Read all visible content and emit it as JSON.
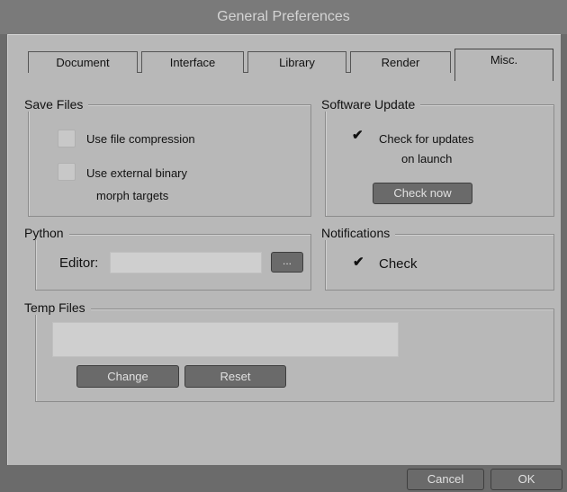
{
  "window": {
    "title": "General Preferences"
  },
  "tabs": [
    {
      "label": "Document",
      "active": false
    },
    {
      "label": "Interface",
      "active": false
    },
    {
      "label": "Library",
      "active": false
    },
    {
      "label": "Render",
      "active": false
    },
    {
      "label": "Misc.",
      "active": true
    }
  ],
  "save_files": {
    "title": "Save Files",
    "compression": {
      "label": "Use file compression",
      "checked": false
    },
    "external_binary": {
      "label_line1": "Use external binary",
      "label_line2": "morph targets",
      "checked": false
    }
  },
  "software_update": {
    "title": "Software Update",
    "check_launch": {
      "label_line1": "Check for updates",
      "label_line2": "on launch",
      "checked": true
    },
    "check_now_label": "Check now"
  },
  "python": {
    "title": "Python",
    "editor_label": "Editor:",
    "editor_value": "",
    "browse_label": "..."
  },
  "notifications": {
    "title": "Notifications",
    "check": {
      "label": "Check",
      "checked": true
    }
  },
  "temp_files": {
    "title": "Temp Files",
    "path_value": "",
    "change_label": "Change",
    "reset_label": "Reset"
  },
  "footer": {
    "cancel_label": "Cancel",
    "ok_label": "OK"
  }
}
